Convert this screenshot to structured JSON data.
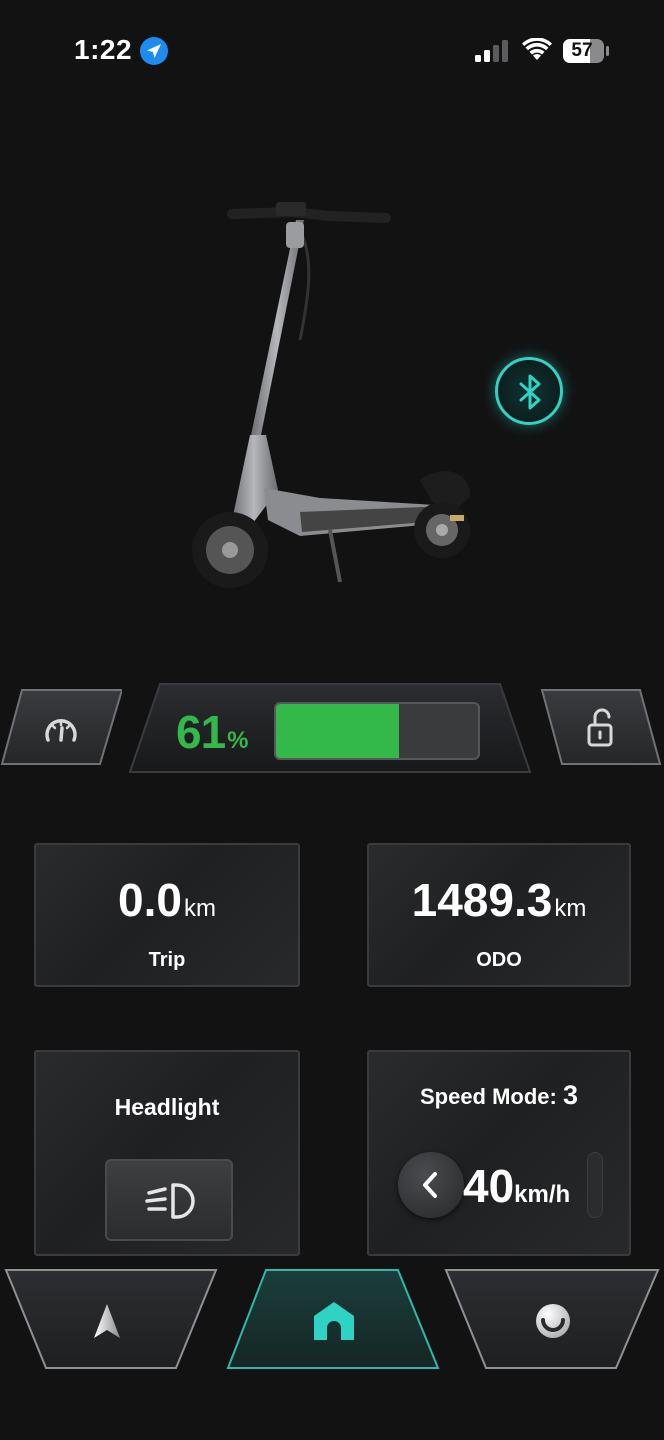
{
  "status_bar": {
    "time": "1:22",
    "battery_level": "57",
    "icons": [
      "location-arrow-icon",
      "cellular-signal-icon",
      "wifi-icon",
      "battery-icon"
    ]
  },
  "device": {
    "image": "electric-scooter",
    "bluetooth_icon": "bluetooth-icon",
    "accent_color": "#2fd3c3"
  },
  "battery": {
    "percent_value": "61",
    "percent_unit": "%",
    "level": 0.61,
    "color": "#33b84a"
  },
  "tabs": {
    "left_icon": "speedometer-icon",
    "right_icon": "unlock-icon"
  },
  "trip": {
    "value": "0.0",
    "unit": "km",
    "label": "Trip"
  },
  "odo": {
    "value": "1489.3",
    "unit": "km",
    "label": "ODO"
  },
  "headlight": {
    "label": "Headlight",
    "icon": "headlight-icon"
  },
  "speed_mode": {
    "label": "Speed Mode:",
    "mode": "3",
    "speed": "40",
    "unit": "km/h"
  },
  "bottom_nav": {
    "items": [
      {
        "icon": "navigation-arrow-icon",
        "active": false
      },
      {
        "icon": "home-icon",
        "active": true
      },
      {
        "icon": "profile-icon",
        "active": false
      }
    ]
  }
}
